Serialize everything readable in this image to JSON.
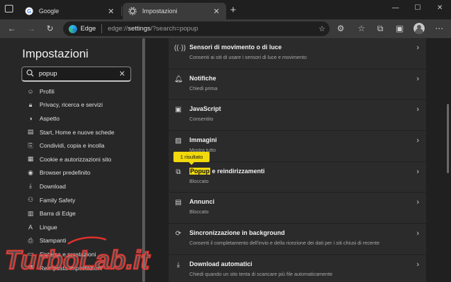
{
  "tabs": [
    {
      "title": "Google",
      "active": false
    },
    {
      "title": "Impostazioni",
      "active": true
    }
  ],
  "toolbar": {
    "brand": "Edge",
    "url_prefix": "edge://",
    "url_main": "settings",
    "url_rest": "/?search=popup"
  },
  "sidebar": {
    "title": "Impostazioni",
    "search": {
      "value": "popup"
    },
    "items": [
      {
        "label": "Profili",
        "icon": "profile-icon"
      },
      {
        "label": "Privacy, ricerca e servizi",
        "icon": "lock-icon"
      },
      {
        "label": "Aspetto",
        "icon": "appearance-icon"
      },
      {
        "label": "Start, Home e nuove schede",
        "icon": "start-icon"
      },
      {
        "label": "Condividi, copia e incolla",
        "icon": "share-icon"
      },
      {
        "label": "Cookie e autorizzazioni sito",
        "icon": "cookie-icon"
      },
      {
        "label": "Browser predefinito",
        "icon": "browser-icon"
      },
      {
        "label": "Download",
        "icon": "download-icon"
      },
      {
        "label": "Family Safety",
        "icon": "family-icon"
      },
      {
        "label": "Barra di Edge",
        "icon": "edge-bar-icon"
      },
      {
        "label": "Lingue",
        "icon": "language-icon"
      },
      {
        "label": "Stampanti",
        "icon": "printer-icon"
      },
      {
        "label": "Sistema e prestazioni",
        "icon": "system-icon"
      },
      {
        "label": "Reimposta impostazioni",
        "icon": "reset-icon"
      }
    ]
  },
  "content": {
    "badge": "1 risultato",
    "highlight": "Popup",
    "rows": [
      {
        "title": "Sensori di movimento o di luce",
        "subtitle": "Consenti ai siti di usare i sensori di luce e movimento",
        "icon": "sensor-icon"
      },
      {
        "title": "Notifiche",
        "subtitle": "Chiedi prima",
        "icon": "bell-icon"
      },
      {
        "title": "JavaScript",
        "subtitle": "Consentito",
        "icon": "javascript-icon"
      },
      {
        "title": "Immagini",
        "subtitle": "Mostra tutto",
        "icon": "image-icon"
      },
      {
        "title": " e reindirizzamenti",
        "subtitle": "Bloccato",
        "icon": "popup-icon"
      },
      {
        "title": "Annunci",
        "subtitle": "Bloccato",
        "icon": "ads-icon"
      },
      {
        "title": "Sincronizzazione in background",
        "subtitle": "Consenti il completamento dell'invio e della ricezione dei dati per i siti chiusi di recente",
        "icon": "sync-icon"
      },
      {
        "title": "Download automatici",
        "subtitle": "Chiedi quando un sito tenta di scaricare più file automaticamente",
        "icon": "download-icon"
      }
    ]
  },
  "watermark": {
    "text": "TurboLab.it",
    "color": "#e0312b"
  }
}
